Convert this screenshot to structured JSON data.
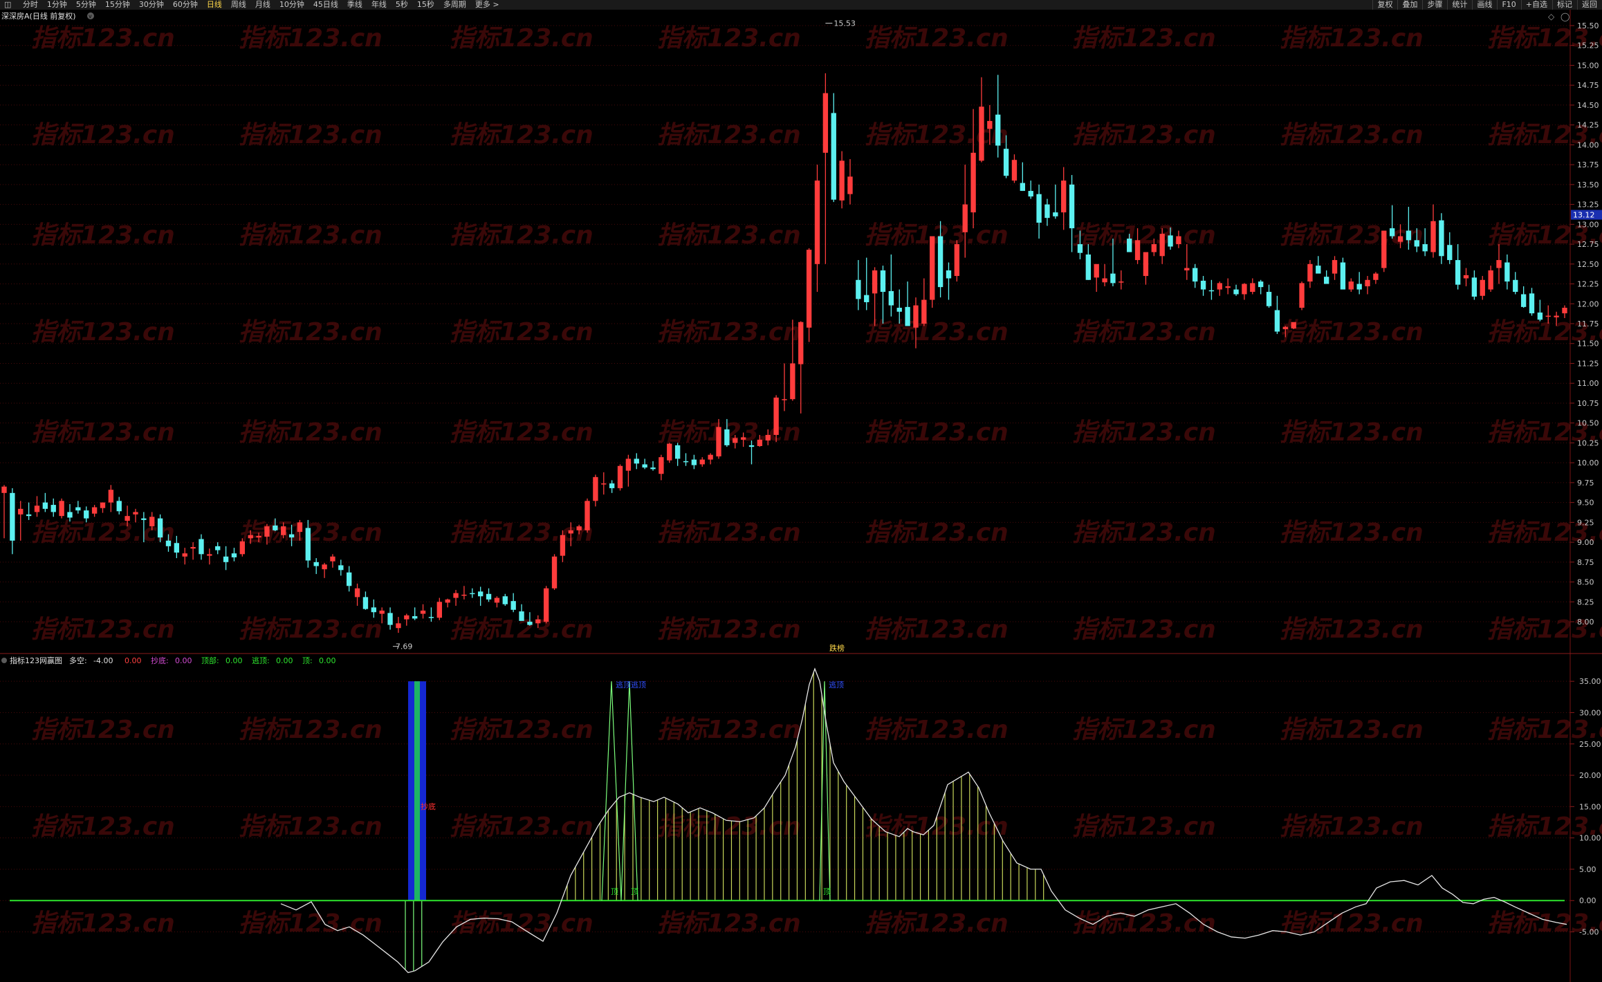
{
  "toolbar": {
    "left_items": [
      "分时",
      "1分钟",
      "5分钟",
      "15分钟",
      "30分钟",
      "60分钟",
      "日线",
      "周线",
      "月线",
      "10分钟",
      "45日线",
      "季线",
      "年线",
      "5秒",
      "15秒",
      "多周期",
      "更多 >"
    ],
    "active": "日线",
    "right_items": [
      "复权",
      "叠加",
      "步骤",
      "统计",
      "画线",
      "F10",
      "+自选",
      "标记",
      "返回"
    ]
  },
  "main_panel": {
    "title": "深深房A(日线 前复权)",
    "axis_labels": [
      "8.00",
      "8.25",
      "8.50",
      "8.75",
      "9.00",
      "9.25",
      "9.50",
      "9.75",
      "10.00",
      "10.25",
      "10.50",
      "10.75",
      "11.00",
      "11.25",
      "11.50",
      "11.75",
      "12.00",
      "12.25",
      "12.50",
      "12.75",
      "13.00",
      "13.25",
      "13.50",
      "13.75",
      "14.00",
      "14.25",
      "14.50",
      "14.75",
      "15.00",
      "15.25",
      "15.50"
    ],
    "price_tag": "13.12",
    "high_label": "15.53",
    "low_label": "7.69",
    "center_label": "跌榜",
    "watermark": "指标123.cn"
  },
  "indicator_panel": {
    "name": "指标123网赢图",
    "values": [
      {
        "label": "多空:",
        "value": "-4.00",
        "color": "#e0e0e0"
      },
      {
        "label": "",
        "value": "0.00",
        "color": "#ff4040"
      },
      {
        "label": "抄底:",
        "value": "0.00",
        "color": "#d24bd2"
      },
      {
        "label": "顶部:",
        "value": "0.00",
        "color": "#2ee62e"
      },
      {
        "label": "逃顶:",
        "value": "0.00",
        "color": "#2ee62e"
      },
      {
        "label": "顶:",
        "value": "0.00",
        "color": "#2ee62e"
      }
    ],
    "axis_labels": [
      "-5.00",
      "0.00",
      "5.00",
      "10.00",
      "15.00",
      "20.00",
      "25.00",
      "30.00",
      "35.00"
    ],
    "signal_labels": {
      "chaodi": "抄底",
      "taoding": "逃顶",
      "taoding2": "逃顶逃顶",
      "ding": "顶"
    }
  },
  "chart_data": {
    "type": "candlestick",
    "title": "深深房A(日线 前复权)",
    "y_range": [
      7.6,
      15.7
    ],
    "max_label": 15.53,
    "min_label": 7.69,
    "current_price": 13.12,
    "candles": [
      [
        9.62,
        9.72,
        9.05,
        9.7
      ],
      [
        9.62,
        9.68,
        8.85,
        9.02
      ],
      [
        9.35,
        9.52,
        9.02,
        9.42
      ],
      [
        9.35,
        9.5,
        9.28,
        9.33
      ],
      [
        9.38,
        9.58,
        9.32,
        9.46
      ],
      [
        9.5,
        9.62,
        9.38,
        9.42
      ],
      [
        9.47,
        9.55,
        9.32,
        9.38
      ],
      [
        9.33,
        9.55,
        9.3,
        9.52
      ],
      [
        9.38,
        9.48,
        9.26,
        9.31
      ],
      [
        9.44,
        9.52,
        9.36,
        9.4
      ],
      [
        9.4,
        9.45,
        9.25,
        9.3
      ],
      [
        9.36,
        9.47,
        9.32,
        9.44
      ],
      [
        9.43,
        9.5,
        9.37,
        9.5
      ],
      [
        9.5,
        9.72,
        9.38,
        9.66
      ],
      [
        9.52,
        9.57,
        9.35,
        9.39
      ],
      [
        9.27,
        9.46,
        9.2,
        9.33
      ],
      [
        9.35,
        9.42,
        9.25,
        9.38
      ],
      [
        9.3,
        9.38,
        9.0,
        9.28
      ],
      [
        9.2,
        9.38,
        9.15,
        9.32
      ],
      [
        9.3,
        9.35,
        9.0,
        9.06
      ],
      [
        9.02,
        9.1,
        8.88,
        8.95
      ],
      [
        8.99,
        9.08,
        8.8,
        8.87
      ],
      [
        8.82,
        8.93,
        8.72,
        8.86
      ],
      [
        8.92,
        9.0,
        8.78,
        8.94
      ],
      [
        9.04,
        9.1,
        8.78,
        8.85
      ],
      [
        8.83,
        8.92,
        8.72,
        8.85
      ],
      [
        8.95,
        9.0,
        8.85,
        8.9
      ],
      [
        8.82,
        8.95,
        8.65,
        8.75
      ],
      [
        8.86,
        8.93,
        8.76,
        8.81
      ],
      [
        8.85,
        9.05,
        8.82,
        9.01
      ],
      [
        9.05,
        9.15,
        8.98,
        9.09
      ],
      [
        9.06,
        9.12,
        9.0,
        9.08
      ],
      [
        9.07,
        9.23,
        8.97,
        9.2
      ],
      [
        9.21,
        9.3,
        9.14,
        9.15
      ],
      [
        9.09,
        9.25,
        9.05,
        9.2
      ],
      [
        9.1,
        9.22,
        8.95,
        9.06
      ],
      [
        9.13,
        9.28,
        9.02,
        9.25
      ],
      [
        9.18,
        9.28,
        8.68,
        8.77
      ],
      [
        8.75,
        8.8,
        8.6,
        8.7
      ],
      [
        8.66,
        8.74,
        8.55,
        8.72
      ],
      [
        8.76,
        8.85,
        8.68,
        8.82
      ],
      [
        8.71,
        8.78,
        8.58,
        8.65
      ],
      [
        8.62,
        8.7,
        8.38,
        8.45
      ],
      [
        8.31,
        8.48,
        8.2,
        8.42
      ],
      [
        8.31,
        8.38,
        8.15,
        8.16
      ],
      [
        8.18,
        8.28,
        8.05,
        8.12
      ],
      [
        8.1,
        8.18,
        7.98,
        8.14
      ],
      [
        8.11,
        8.18,
        7.9,
        7.96
      ],
      [
        7.92,
        8.06,
        7.86,
        7.98
      ],
      [
        8.03,
        8.1,
        7.95,
        8.08
      ],
      [
        8.07,
        8.18,
        8.02,
        8.04
      ],
      [
        8.1,
        8.22,
        8.04,
        8.14
      ],
      [
        8.06,
        8.18,
        8.0,
        8.05
      ],
      [
        8.05,
        8.3,
        8.02,
        8.25
      ],
      [
        8.24,
        8.29,
        8.18,
        8.28
      ],
      [
        8.3,
        8.4,
        8.2,
        8.36
      ],
      [
        8.33,
        8.45,
        8.28,
        8.34
      ],
      [
        8.36,
        8.42,
        8.3,
        8.35
      ],
      [
        8.38,
        8.44,
        8.2,
        8.32
      ],
      [
        8.35,
        8.42,
        8.25,
        8.28
      ],
      [
        8.24,
        8.32,
        8.18,
        8.3
      ],
      [
        8.32,
        8.35,
        8.2,
        8.22
      ],
      [
        8.26,
        8.36,
        8.12,
        8.15
      ],
      [
        8.13,
        8.22,
        8.05,
        8.01
      ],
      [
        8.0,
        8.12,
        7.95,
        7.96
      ],
      [
        7.98,
        8.08,
        7.92,
        8.03
      ],
      [
        8.0,
        8.45,
        7.98,
        8.42
      ],
      [
        8.42,
        8.85,
        8.4,
        8.82
      ],
      [
        8.83,
        9.15,
        8.75,
        9.09
      ],
      [
        9.11,
        9.25,
        8.95,
        9.15
      ],
      [
        9.15,
        9.22,
        9.1,
        9.2
      ],
      [
        9.15,
        9.55,
        9.12,
        9.52
      ],
      [
        9.52,
        9.85,
        9.45,
        9.82
      ],
      [
        9.73,
        9.88,
        9.6,
        9.74
      ],
      [
        9.74,
        9.78,
        9.62,
        9.68
      ],
      [
        9.68,
        9.98,
        9.65,
        9.96
      ],
      [
        9.9,
        10.1,
        9.7,
        10.05
      ],
      [
        10.05,
        10.12,
        9.92,
        9.99
      ],
      [
        9.98,
        10.05,
        9.92,
        9.94
      ],
      [
        9.94,
        10.02,
        9.9,
        9.92
      ],
      [
        9.86,
        10.1,
        9.78,
        10.07
      ],
      [
        10.03,
        10.25,
        10.0,
        10.24
      ],
      [
        10.22,
        10.25,
        9.96,
        10.05
      ],
      [
        10.02,
        10.12,
        9.96,
        10.01
      ],
      [
        10.04,
        10.1,
        9.92,
        9.97
      ],
      [
        9.98,
        10.07,
        9.95,
        10.04
      ],
      [
        10.04,
        10.12,
        9.98,
        10.1
      ],
      [
        10.08,
        10.55,
        10.05,
        10.45
      ],
      [
        10.42,
        10.55,
        10.2,
        10.22
      ],
      [
        10.25,
        10.35,
        10.18,
        10.31
      ],
      [
        10.29,
        10.38,
        10.2,
        10.32
      ],
      [
        10.22,
        10.28,
        9.98,
        10.2
      ],
      [
        10.21,
        10.35,
        10.2,
        10.29
      ],
      [
        10.28,
        10.42,
        10.22,
        10.35
      ],
      [
        10.35,
        10.85,
        10.26,
        10.82
      ],
      [
        10.79,
        11.25,
        10.65,
        10.8
      ],
      [
        10.8,
        11.8,
        10.78,
        11.25
      ],
      [
        11.24,
        11.78,
        10.62,
        11.77
      ],
      [
        11.7,
        12.7,
        11.52,
        12.68
      ],
      [
        12.5,
        13.75,
        12.15,
        13.55
      ],
      [
        13.9,
        14.9,
        12.5,
        14.65
      ],
      [
        14.4,
        14.65,
        13.28,
        13.31
      ],
      [
        13.3,
        13.92,
        13.2,
        13.8
      ],
      [
        13.38,
        13.82,
        13.25,
        13.6
      ],
      [
        12.3,
        12.55,
        11.92,
        12.06
      ],
      [
        12.11,
        12.58,
        11.92,
        12.02
      ],
      [
        12.13,
        12.46,
        11.72,
        12.42
      ],
      [
        12.42,
        12.48,
        11.75,
        12.15
      ],
      [
        12.16,
        12.62,
        11.84,
        11.98
      ],
      [
        11.95,
        12.18,
        11.75,
        11.9
      ],
      [
        11.96,
        12.28,
        11.85,
        11.72
      ],
      [
        11.7,
        12.08,
        11.44,
        11.98
      ],
      [
        11.75,
        12.32,
        11.72,
        12.05
      ],
      [
        12.05,
        12.35,
        11.95,
        12.85
      ],
      [
        12.85,
        13.04,
        12.08,
        12.21
      ],
      [
        12.42,
        12.52,
        12.05,
        12.32
      ],
      [
        12.35,
        12.8,
        12.28,
        12.75
      ],
      [
        12.9,
        13.75,
        12.58,
        13.25
      ],
      [
        13.15,
        14.45,
        12.95,
        13.9
      ],
      [
        13.8,
        14.85,
        13.78,
        14.48
      ],
      [
        14.2,
        14.5,
        14.0,
        14.3
      ],
      [
        14.38,
        14.88,
        13.84,
        13.99
      ],
      [
        13.95,
        14.12,
        13.58,
        13.61
      ],
      [
        13.55,
        13.88,
        13.52,
        13.81
      ],
      [
        13.52,
        13.78,
        13.42,
        13.42
      ],
      [
        13.42,
        13.55,
        13.32,
        13.35
      ],
      [
        13.38,
        13.5,
        12.82,
        13.02
      ],
      [
        13.25,
        13.32,
        12.98,
        13.08
      ],
      [
        13.15,
        13.5,
        13.07,
        13.1
      ],
      [
        13.15,
        13.72,
        12.93,
        13.55
      ],
      [
        13.5,
        13.62,
        12.65,
        12.95
      ],
      [
        12.75,
        12.92,
        12.56,
        12.64
      ],
      [
        12.62,
        12.75,
        12.3,
        12.3
      ],
      [
        12.33,
        12.48,
        12.15,
        12.5
      ],
      [
        12.27,
        12.5,
        12.22,
        12.32
      ],
      [
        12.38,
        12.82,
        12.22,
        12.26
      ],
      [
        12.27,
        12.42,
        12.18,
        12.28
      ],
      [
        12.82,
        12.88,
        12.75,
        12.65
      ],
      [
        12.55,
        12.95,
        12.5,
        12.8
      ],
      [
        12.35,
        12.5,
        12.24,
        12.65
      ],
      [
        12.65,
        12.82,
        12.6,
        12.75
      ],
      [
        12.6,
        12.95,
        12.5,
        12.88
      ],
      [
        12.86,
        12.96,
        12.68,
        12.72
      ],
      [
        12.75,
        12.92,
        12.7,
        12.85
      ],
      [
        12.42,
        12.75,
        12.3,
        12.45
      ],
      [
        12.45,
        12.5,
        12.2,
        12.28
      ],
      [
        12.29,
        12.35,
        12.1,
        12.18
      ],
      [
        12.17,
        12.3,
        12.05,
        12.16
      ],
      [
        12.18,
        12.28,
        12.1,
        12.26
      ],
      [
        12.2,
        12.32,
        12.12,
        12.22
      ],
      [
        12.18,
        12.24,
        12.1,
        12.12
      ],
      [
        12.12,
        12.26,
        12.05,
        12.25
      ],
      [
        12.15,
        12.32,
        12.12,
        12.26
      ],
      [
        12.28,
        12.3,
        12.12,
        12.21
      ],
      [
        12.15,
        12.24,
        11.95,
        11.97
      ],
      [
        11.92,
        12.1,
        11.62,
        11.65
      ],
      [
        11.68,
        11.72,
        11.58,
        11.71
      ],
      [
        11.69,
        11.75,
        11.68,
        11.77
      ],
      [
        11.95,
        12.28,
        11.92,
        12.26
      ],
      [
        12.28,
        12.55,
        12.2,
        12.5
      ],
      [
        12.48,
        12.6,
        12.4,
        12.38
      ],
      [
        12.34,
        12.42,
        12.3,
        12.25
      ],
      [
        12.38,
        12.6,
        12.3,
        12.55
      ],
      [
        12.52,
        12.58,
        12.3,
        12.18
      ],
      [
        12.18,
        12.32,
        12.15,
        12.28
      ],
      [
        12.25,
        12.4,
        12.12,
        12.18
      ],
      [
        12.22,
        12.35,
        12.12,
        12.3
      ],
      [
        12.3,
        12.4,
        12.25,
        12.38
      ],
      [
        12.45,
        12.92,
        12.4,
        12.92
      ],
      [
        12.95,
        13.24,
        12.82,
        12.85
      ],
      [
        12.78,
        13.0,
        12.7,
        12.85
      ],
      [
        12.92,
        13.22,
        12.68,
        12.8
      ],
      [
        12.8,
        12.95,
        12.65,
        12.72
      ],
      [
        12.75,
        12.95,
        12.6,
        12.66
      ],
      [
        12.65,
        13.25,
        12.58,
        13.04
      ],
      [
        13.05,
        13.14,
        12.5,
        12.6
      ],
      [
        12.74,
        12.9,
        12.5,
        12.55
      ],
      [
        12.55,
        12.75,
        12.18,
        12.24
      ],
      [
        12.32,
        12.45,
        12.22,
        12.36
      ],
      [
        12.33,
        12.42,
        12.05,
        12.09
      ],
      [
        12.1,
        12.35,
        12.05,
        12.3
      ],
      [
        12.18,
        12.48,
        12.15,
        12.42
      ],
      [
        12.45,
        12.75,
        12.25,
        12.55
      ],
      [
        12.52,
        12.62,
        12.18,
        12.28
      ],
      [
        12.3,
        12.4,
        12.12,
        12.15
      ],
      [
        12.12,
        12.22,
        11.95,
        11.96
      ],
      [
        12.13,
        12.2,
        11.85,
        11.88
      ],
      [
        11.89,
        12.05,
        11.78,
        11.8
      ],
      [
        11.85,
        11.98,
        11.75,
        11.85
      ],
      [
        11.83,
        11.9,
        11.72,
        11.85
      ],
      [
        11.88,
        11.98,
        11.82,
        11.95
      ]
    ],
    "indicator": {
      "zero_line": 0,
      "y_range": [
        -13,
        38
      ]
    }
  }
}
